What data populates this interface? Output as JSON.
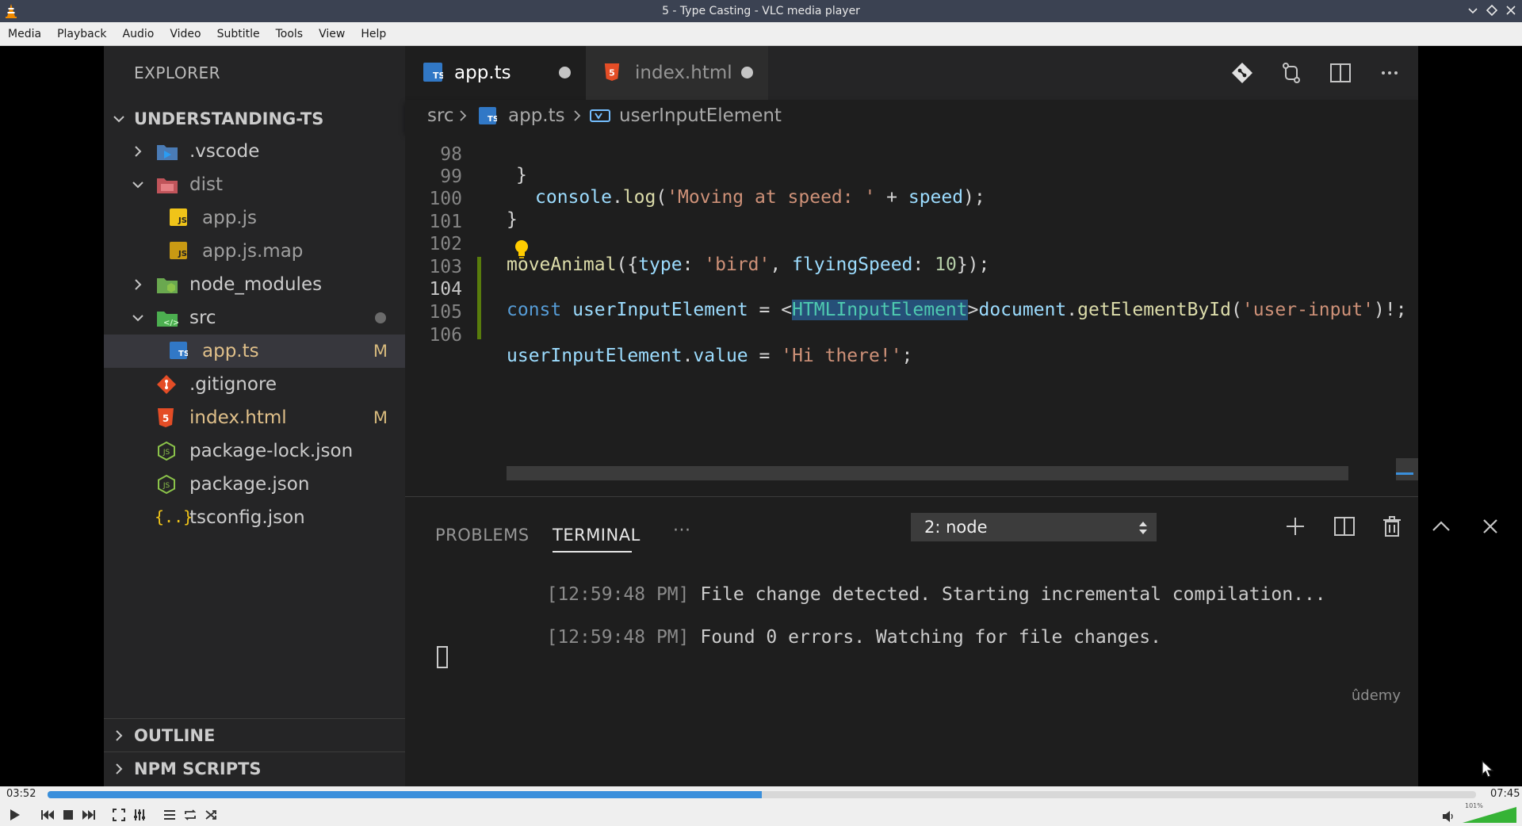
{
  "titlebar": {
    "title": "5 - Type Casting - VLC media player"
  },
  "menubar": {
    "items": [
      "Media",
      "Playback",
      "Audio",
      "Video",
      "Subtitle",
      "Tools",
      "View",
      "Help"
    ]
  },
  "sidebar": {
    "header": "EXPLORER",
    "project": "UNDERSTANDING-TS",
    "items": [
      {
        "name": ".vscode",
        "type": "folder",
        "expanded": false
      },
      {
        "name": "dist",
        "type": "folder",
        "expanded": true
      },
      {
        "name": "app.js",
        "type": "file"
      },
      {
        "name": "app.js.map",
        "type": "file"
      },
      {
        "name": "node_modules",
        "type": "folder",
        "expanded": false
      },
      {
        "name": "src",
        "type": "folder",
        "expanded": true
      },
      {
        "name": "app.ts",
        "type": "file",
        "status": "M"
      },
      {
        "name": ".gitignore",
        "type": "file"
      },
      {
        "name": "index.html",
        "type": "file",
        "status": "M"
      },
      {
        "name": "package-lock.json",
        "type": "file"
      },
      {
        "name": "package.json",
        "type": "file"
      },
      {
        "name": "tsconfig.json",
        "type": "file"
      }
    ],
    "outline": "OUTLINE",
    "npm_scripts": "NPM SCRIPTS"
  },
  "tabs": [
    {
      "label": "app.ts",
      "active": true,
      "icon_text": "TS"
    },
    {
      "label": "index.html",
      "active": false
    }
  ],
  "breadcrumb": {
    "parts": [
      "src",
      "app.ts",
      "userInputElement"
    ],
    "ts_icon": "TS"
  },
  "editor": {
    "lines": [
      {
        "n": "98",
        "code": "  }"
      },
      {
        "n": "99",
        "code": "  console.log('Moving at speed: ' + speed);"
      },
      {
        "n": "100",
        "code": "}"
      },
      {
        "n": "101",
        "code": ""
      },
      {
        "n": "102",
        "code": "moveAnimal({type: 'bird', flyingSpeed: 10});"
      },
      {
        "n": "103",
        "code": ""
      },
      {
        "n": "104",
        "code": "const userInputElement = <HTMLInputElement>document.getElementById('user-input')!;"
      },
      {
        "n": "105",
        "code": ""
      },
      {
        "n": "106",
        "code": "userInputElement.value = 'Hi there!';"
      }
    ]
  },
  "panel": {
    "tabs": [
      "PROBLEMS",
      "TERMINAL"
    ],
    "more": "···",
    "terminal_select": "2: node",
    "terminal_lines": [
      {
        "ts": "[12:59:48 PM]",
        "msg": " File change detected. Starting incremental compilation..."
      },
      {
        "ts": "[12:59:48 PM]",
        "msg": " Found 0 errors. Watching for file changes."
      }
    ],
    "watermark": "ûdemy"
  },
  "player": {
    "elapsed": "03:52",
    "total": "07:45",
    "progress_fraction": 0.5,
    "volume_label": "101%",
    "volume_fraction": 1.0
  },
  "colors": {
    "accent": "#3a8fdb",
    "ts_blue": "#3178c6",
    "html_orange": "#e44d26"
  }
}
